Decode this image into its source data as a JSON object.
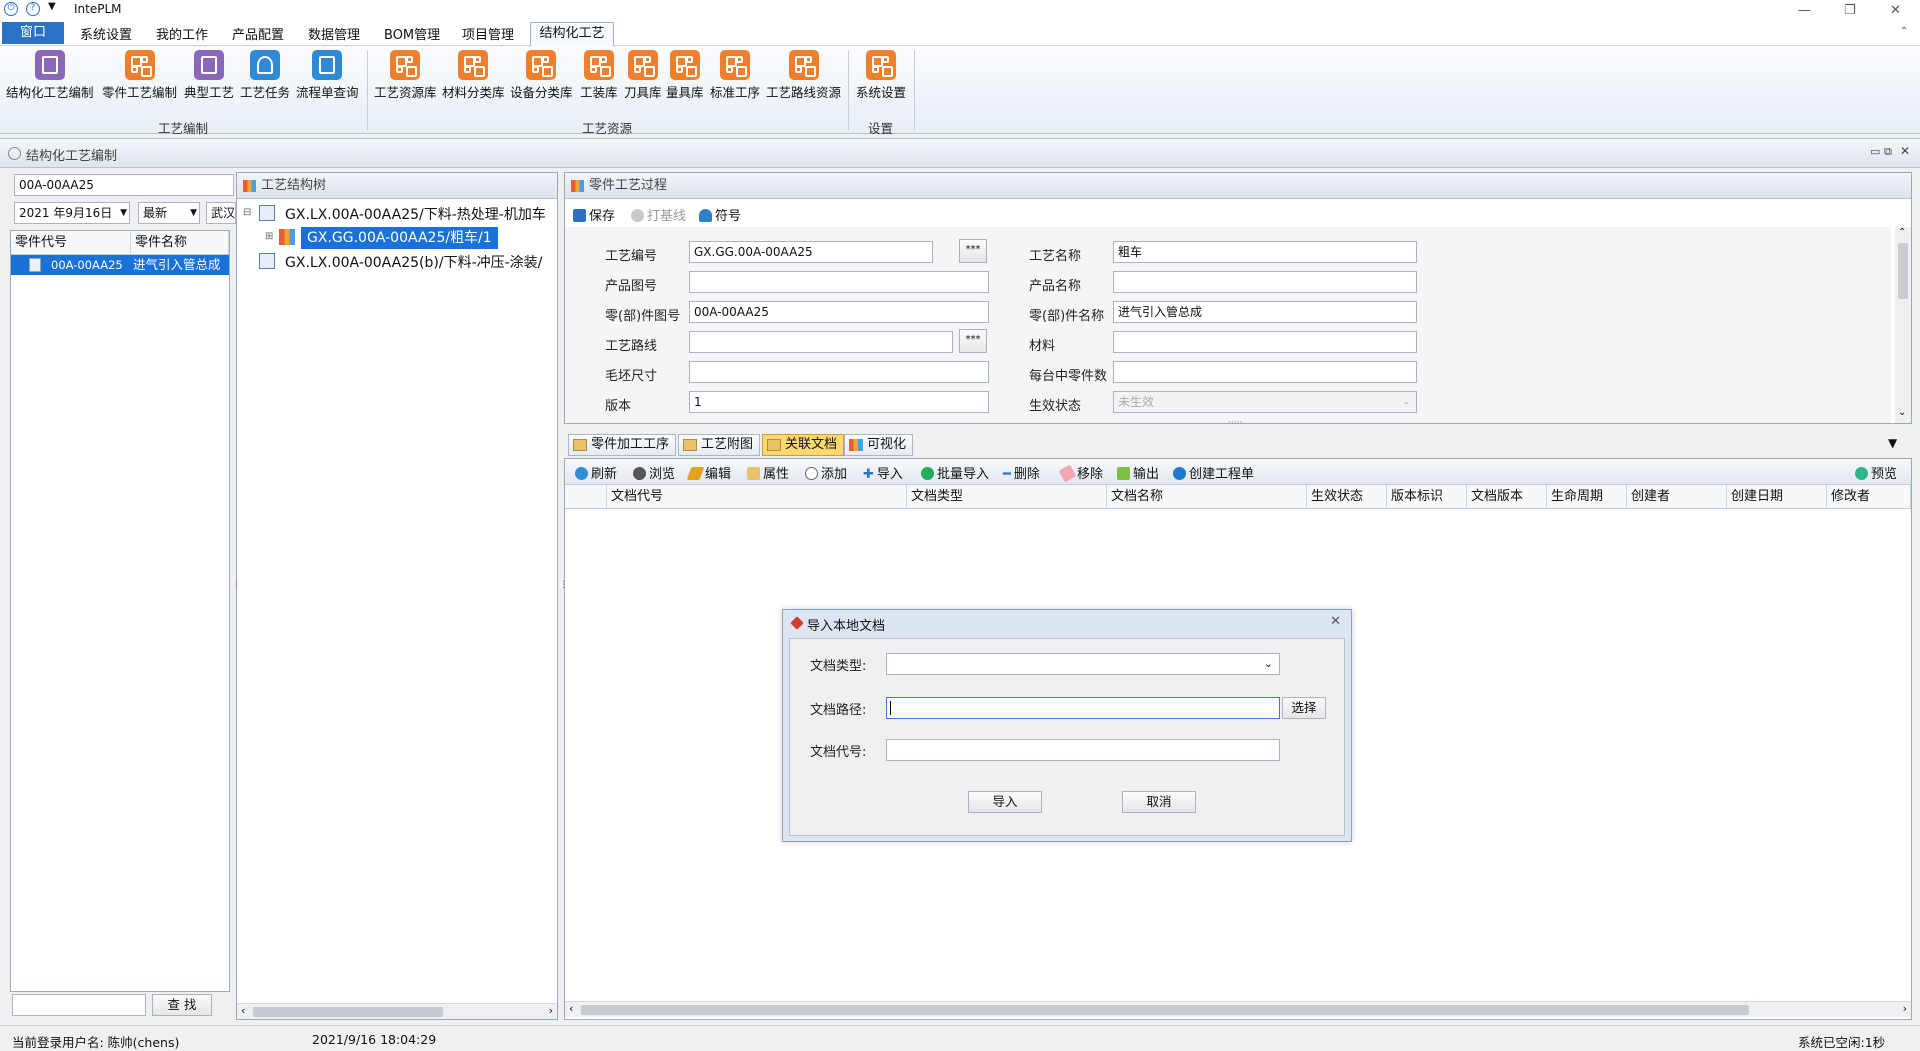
{
  "app": {
    "title": "IntePLM"
  },
  "menu": {
    "window": "窗口",
    "items": [
      "系统设置",
      "我的工作",
      "产品配置",
      "数据管理",
      "BOM管理",
      "项目管理",
      "结构化工艺"
    ]
  },
  "ribbon": {
    "groups": [
      {
        "label": "工艺编制",
        "buttons": [
          "结构化工艺编制",
          "零件工艺编制",
          "典型工艺",
          "工艺任务",
          "流程单查询"
        ]
      },
      {
        "label": "工艺资源",
        "buttons": [
          "工艺资源库",
          "材料分类库",
          "设备分类库",
          "工装库",
          "刀具库",
          "量具库",
          "标准工序",
          "工艺路线资源"
        ]
      },
      {
        "label": "设置",
        "buttons": [
          "系统设置"
        ]
      }
    ]
  },
  "subwindow": {
    "title": "结构化工艺编制"
  },
  "left": {
    "search_value": "00A-00AA25",
    "date_value": "2021 年9月16日",
    "version_value": "最新",
    "site_value": "武汉",
    "columns": [
      "零件代号",
      "零件名称"
    ],
    "row": {
      "code": "00A-00AA25",
      "name": "进气引入管总成"
    },
    "find_button": "查 找"
  },
  "tree": {
    "title": "工艺结构树",
    "nodes": [
      "GX.LX.00A-00AA25/下料-热处理-机加车",
      "GX.GG.00A-00AA25/粗车/1",
      "GX.LX.00A-00AA25(b)/下料-冲压-涂装/"
    ]
  },
  "process": {
    "title": "零件工艺过程",
    "toolbar": {
      "save": "保存",
      "baseline": "打基线",
      "symbol": "符号"
    },
    "fields": {
      "code_label": "工艺编号",
      "code_value": "GX.GG.00A-00AA25",
      "name_label": "工艺名称",
      "name_value": "粗车",
      "drawing_label": "产品图号",
      "drawing_value": "",
      "product_label": "产品名称",
      "product_value": "",
      "part_no_label": "零(部)件图号",
      "part_no_value": "00A-00AA25",
      "part_name_label": "零(部)件名称",
      "part_name_value": "进气引入管总成",
      "route_label": "工艺路线",
      "route_value": "",
      "material_label": "材料",
      "material_value": "",
      "blank_label": "毛坯尺寸",
      "blank_value": "",
      "qty_label": "每台中零件数",
      "qty_value": "",
      "version_label": "版本",
      "version_value": "1",
      "state_label": "生效状态",
      "state_value": "未生效"
    },
    "more_button": "***"
  },
  "tabs": [
    "零件加工工序",
    "工艺附图",
    "关联文档",
    "可视化"
  ],
  "doc_toolbar": [
    "刷新",
    "浏览",
    "编辑",
    "属性",
    "添加",
    "导入",
    "批量导入",
    "删除",
    "移除",
    "输出",
    "创建工程单"
  ],
  "preview": "预览",
  "doc_columns": [
    "文档代号",
    "文档类型",
    "文档名称",
    "生效状态",
    "版本标识",
    "文档版本",
    "生命周期",
    "创建者",
    "创建日期",
    "修改者"
  ],
  "dialog": {
    "title": "导入本地文档",
    "type_label": "文档类型:",
    "path_label": "文档路径:",
    "code_label": "文档代号:",
    "select_button": "选择",
    "import_button": "导入",
    "cancel_button": "取消"
  },
  "status": {
    "user": "当前登录用户名: 陈帅(chens)",
    "time": "2021/9/16 18:04:29",
    "idle": "系统已空闲:1秒"
  }
}
